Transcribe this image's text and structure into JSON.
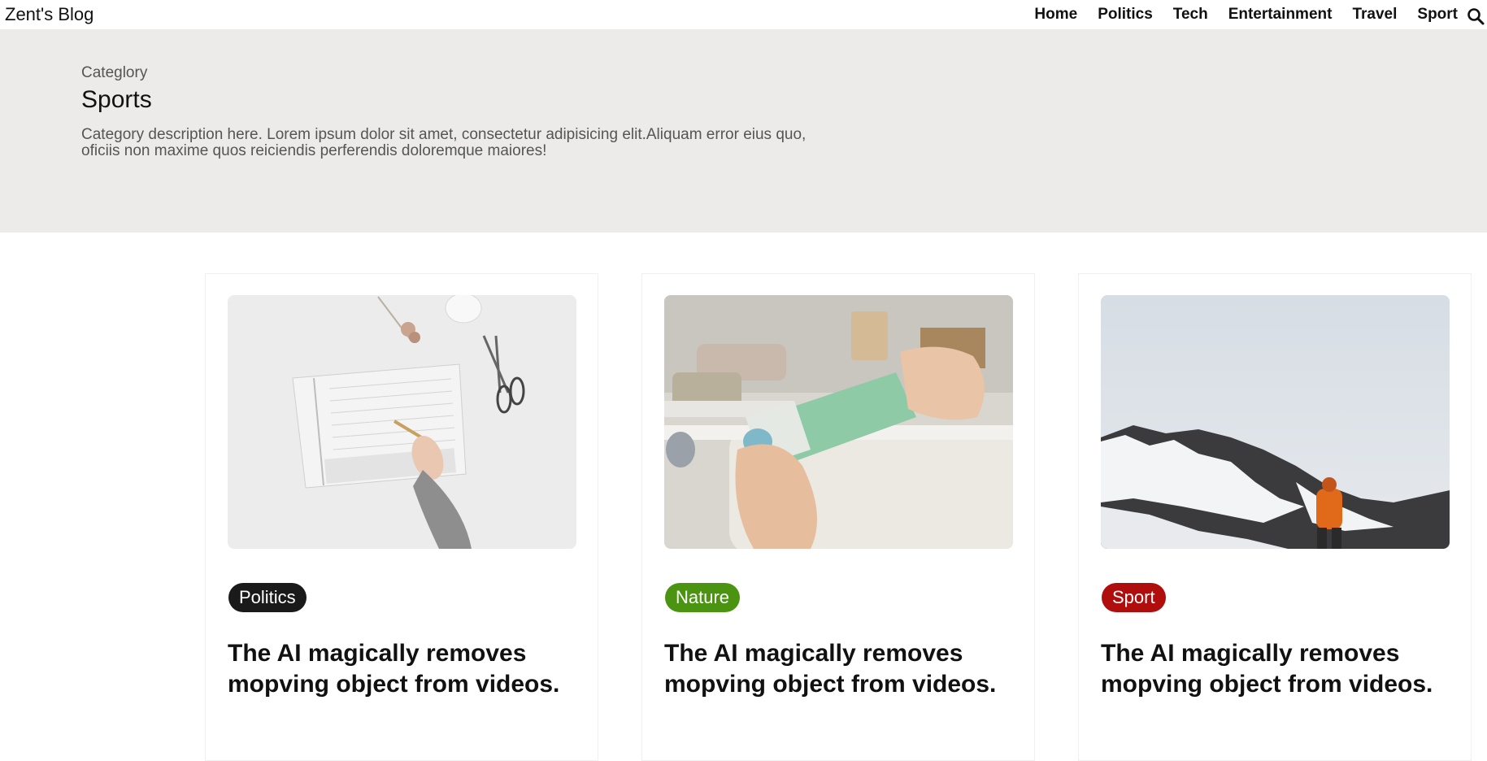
{
  "header": {
    "brand": "Zent's Blog",
    "nav": [
      "Home",
      "Politics",
      "Tech",
      "Entertainment",
      "Travel",
      "Sport"
    ],
    "search_icon": "search-icon"
  },
  "hero": {
    "kicker": "Categlory",
    "title": "Sports",
    "description": "Category description here. Lorem ipsum dolor sit amet, consectetur adipisicing elit.Aliquam error eius quo, oficiis non maxime quos reiciendis perferendis doloremque maiores!"
  },
  "colors": {
    "hero_bg": "#ecebe9",
    "tag_politics": "#1a1a1a",
    "tag_nature": "#4a9412",
    "tag_sport": "#b00d0d"
  },
  "posts": [
    {
      "image": "notebook-writing-photo",
      "tag": "Politics",
      "tag_color": "#1a1a1a",
      "title": "The AI magically removes mopving object from videos."
    },
    {
      "image": "hands-opening-box-photo",
      "tag": "Nature",
      "tag_color": "#4a9412",
      "title": "The AI magically removes mopving object from videos."
    },
    {
      "image": "snowy-mountain-hiker-photo",
      "tag": "Sport",
      "tag_color": "#b00d0d",
      "title": "The AI magically removes mopving object from videos."
    }
  ]
}
